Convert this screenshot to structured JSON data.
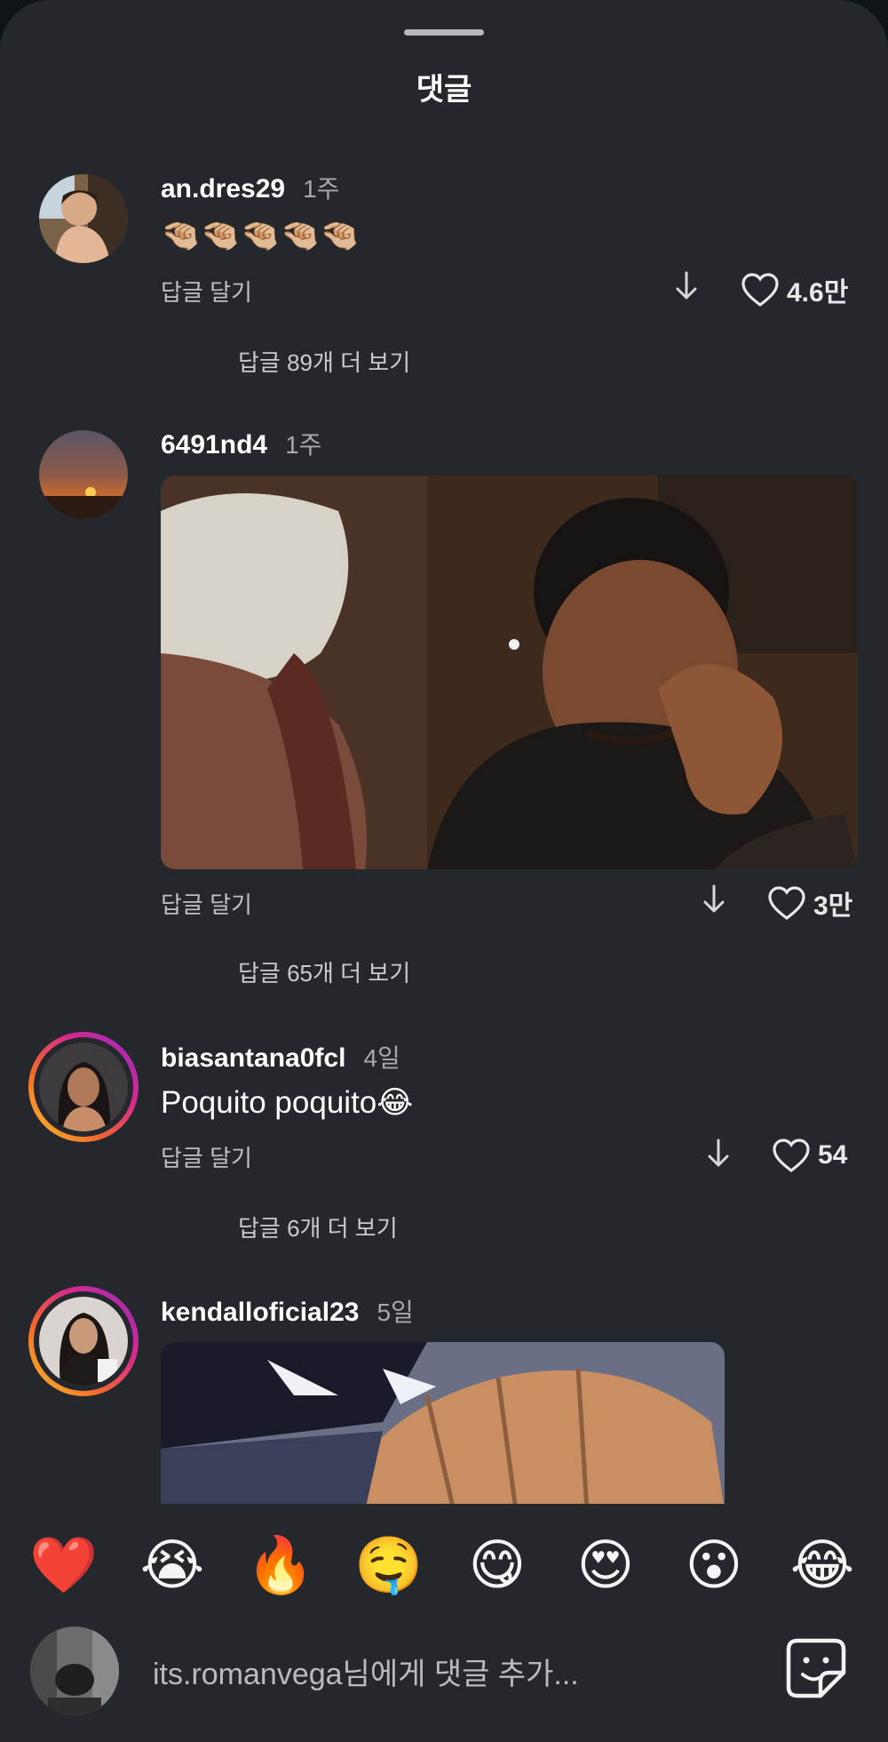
{
  "header": {
    "title": "댓글"
  },
  "comments": [
    {
      "username": "an.dres29",
      "time": "1주",
      "text": "🤏🏼🤏🏼🤏🏼🤏🏼🤏🏼",
      "reply_label": "답글 달기",
      "likes": "4.6만",
      "more_replies": "답글 89개 더 보기"
    },
    {
      "username": "6491nd4",
      "time": "1주",
      "reply_label": "답글 달기",
      "likes": "3만",
      "more_replies": "답글 65개 더 보기"
    },
    {
      "username": "biasantana0fcl",
      "time": "4일",
      "text": "Poquito poquito😂",
      "reply_label": "답글 달기",
      "likes": "54",
      "more_replies": "답글 6개 더 보기"
    },
    {
      "username": "kendalloficial23",
      "time": "5일"
    }
  ],
  "reactions": [
    "❤️",
    "😭",
    "🔥",
    "🤤",
    "😋",
    "😍",
    "😮",
    "😂"
  ],
  "composer": {
    "placeholder": "its.romanvega님에게 댓글 추가..."
  },
  "icons": {
    "down": "down-arrow-icon",
    "like": "heart-icon",
    "sticker": "sticker-icon"
  },
  "colors": {
    "background": "#24272c",
    "ring_start": "#f9c72c",
    "ring_end": "#8e2fc4"
  }
}
